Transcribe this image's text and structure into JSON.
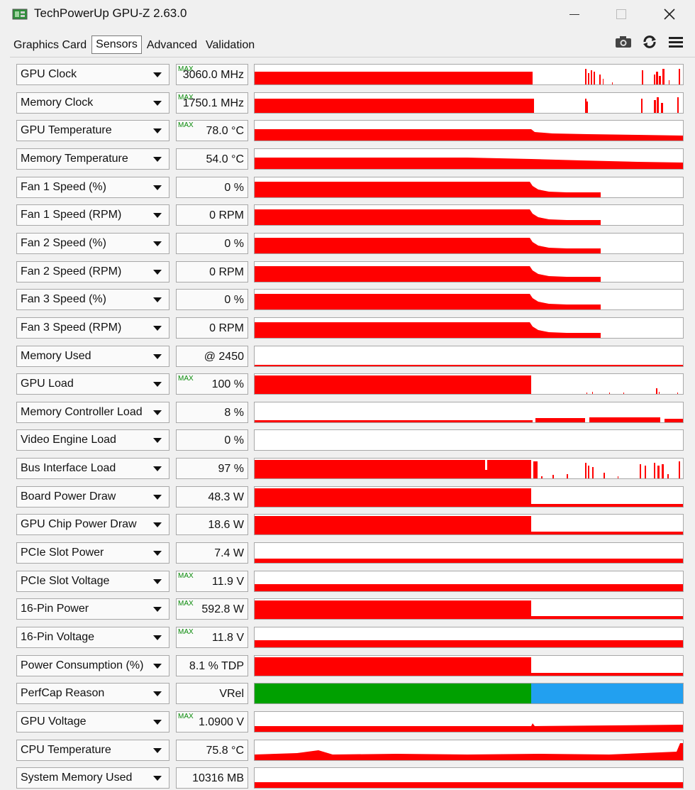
{
  "window": {
    "title": "TechPowerUp GPU-Z 2.63.0",
    "minimize_icon": "minimize-icon",
    "maximize_icon": "maximize-icon",
    "close_icon": "close-icon"
  },
  "tabs": [
    {
      "label": "Graphics Card",
      "active": false
    },
    {
      "label": "Sensors",
      "active": true
    },
    {
      "label": "Advanced",
      "active": false
    },
    {
      "label": "Validation",
      "active": false
    }
  ],
  "toolbar": {
    "screenshot_icon": "camera-icon",
    "refresh_icon": "refresh-icon",
    "menu_icon": "hamburger-menu-icon"
  },
  "colors": {
    "graph_red": "#ff0000",
    "perfcap_green": "#00a000",
    "perfcap_blue": "#22a0f0",
    "max_label": "#0a8a0a"
  },
  "sensors": [
    {
      "name": "GPU Clock",
      "value": "3060.0 MHz",
      "max": "MAX",
      "graph": "spiky_clock"
    },
    {
      "name": "Memory Clock",
      "value": "1750.1 MHz",
      "max": "MAX",
      "graph": "spiky_mem"
    },
    {
      "name": "GPU Temperature",
      "value": "78.0 °C",
      "max": "MAX",
      "graph": "temp_decay"
    },
    {
      "name": "Memory Temperature",
      "value": "54.0 °C",
      "max": "",
      "graph": "memtemp"
    },
    {
      "name": "Fan 1 Speed (%)",
      "value": "0 %",
      "max": "",
      "graph": "fan"
    },
    {
      "name": "Fan 1 Speed (RPM)",
      "value": "0 RPM",
      "max": "",
      "graph": "fan"
    },
    {
      "name": "Fan 2 Speed (%)",
      "value": "0 %",
      "max": "",
      "graph": "fan"
    },
    {
      "name": "Fan 2 Speed (RPM)",
      "value": "0 RPM",
      "max": "",
      "graph": "fan"
    },
    {
      "name": "Fan 3 Speed (%)",
      "value": "0 %",
      "max": "",
      "graph": "fan"
    },
    {
      "name": "Fan 3 Speed (RPM)",
      "value": "0 RPM",
      "max": "",
      "graph": "fan"
    },
    {
      "name": "Memory Used",
      "value": "@ 2450",
      "max": "",
      "graph": "thin_line"
    },
    {
      "name": "GPU Load",
      "value": "100 %",
      "max": "MAX",
      "graph": "load"
    },
    {
      "name": "Memory Controller Load",
      "value": "8 %",
      "max": "",
      "graph": "mcload"
    },
    {
      "name": "Video Engine Load",
      "value": "0 %",
      "max": "",
      "graph": "empty"
    },
    {
      "name": "Bus Interface Load",
      "value": "97 %",
      "max": "",
      "graph": "busload"
    },
    {
      "name": "Board Power Draw",
      "value": "48.3 W",
      "max": "",
      "graph": "power"
    },
    {
      "name": "GPU Chip Power Draw",
      "value": "18.6 W",
      "max": "",
      "graph": "power"
    },
    {
      "name": "PCIe Slot Power",
      "value": "7.4 W",
      "max": "",
      "graph": "low_power"
    },
    {
      "name": "PCIe Slot Voltage",
      "value": "11.9 V",
      "max": "MAX",
      "graph": "voltage"
    },
    {
      "name": "16-Pin Power",
      "value": "592.8 W",
      "max": "MAX",
      "graph": "power"
    },
    {
      "name": "16-Pin Voltage",
      "value": "11.8 V",
      "max": "MAX",
      "graph": "voltage"
    },
    {
      "name": "Power Consumption (%)",
      "value": "8.1 % TDP",
      "max": "",
      "graph": "power"
    },
    {
      "name": "PerfCap Reason",
      "value": "VRel",
      "max": "",
      "graph": "perfcap"
    },
    {
      "name": "GPU Voltage",
      "value": "1.0900 V",
      "max": "MAX",
      "graph": "gpuvolt"
    },
    {
      "name": "CPU Temperature",
      "value": "75.8 °C",
      "max": "",
      "graph": "cputemp"
    },
    {
      "name": "System Memory Used",
      "value": "10316 MB",
      "max": "",
      "graph": "sysmem"
    }
  ]
}
